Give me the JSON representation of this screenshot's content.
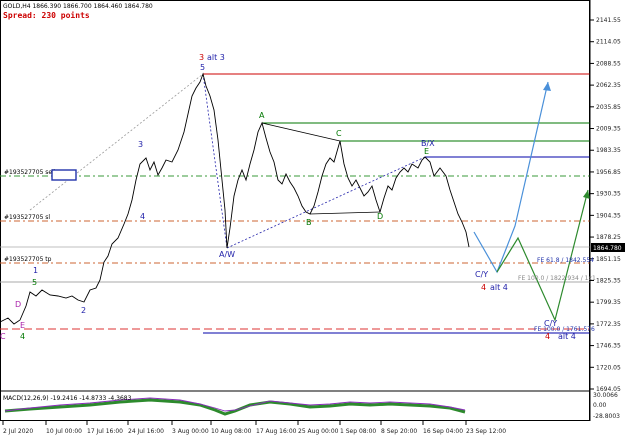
{
  "header": {
    "symbol_info": "GOLD,H4  1866.390 1866.700 1864.460 1864.780",
    "spread": "Spread: 230 points"
  },
  "price_axis": {
    "ticks": [
      "2141.55",
      "2114.05",
      "2088.55",
      "2062.35",
      "2035.85",
      "2009.35",
      "1983.35",
      "1956.85",
      "1930.35",
      "1904.35",
      "1878.25",
      "1851.15",
      "1825.35",
      "1799.35",
      "1772.35",
      "1746.35",
      "1720.05",
      "1694.05"
    ],
    "current_price": "1864.780"
  },
  "macd_axis": {
    "ticks": [
      "30.0066",
      "0.00",
      "-28.8003"
    ]
  },
  "time_axis": {
    "ticks": [
      "2 Jul 2020",
      "10 Jul 00:00",
      "17 Jul 16:00",
      "24 Jul 16:00",
      "3 Aug 00:00",
      "10 Aug 08:00",
      "17 Aug 16:00",
      "25 Aug 00:00",
      "1 Sep 08:00",
      "8 Sep 20:00",
      "16 Sep 04:00",
      "23 Sep 12:00"
    ]
  },
  "order_labels": {
    "sell": "#193527705 sell",
    "sl": "#193527705 sl",
    "tp": "#193527705 tp"
  },
  "fib_labels": {
    "fe618": "FE 61.8 / 1842.554",
    "fe100a": "FE 100.0 / 1822.934 / 1x1",
    "fe100b": "FE 100.0 / 1761.576"
  },
  "macd_label": "MACD(12,26,9) -19.2416 -14.8733 -4.3683",
  "wave_labels": {
    "top3": "3",
    "alt3": "alt 3",
    "top5": "5",
    "A": "A",
    "B": "B",
    "C": "C",
    "D": "D",
    "E": "E",
    "BX": "B/X",
    "AW": "A/W",
    "CY": "C/Y",
    "red4a": "4",
    "alt4a": "alt 4",
    "red4b": "4",
    "alt4b": "alt 4",
    "CYb": "C/Y",
    "w3": "3",
    "w4": "4",
    "w1": "1",
    "w5": "5",
    "w2": "2",
    "wD": "D",
    "wE": "E",
    "w4b": "4",
    "wC": "C"
  },
  "colors": {
    "red_line": "#cc0000",
    "green_line": "#007700",
    "blue_line": "#0000cc",
    "blue_arrow": "#4a90d9",
    "macd_hist": "#2d8a2d",
    "macd_signal": "#8a2dbb"
  }
}
